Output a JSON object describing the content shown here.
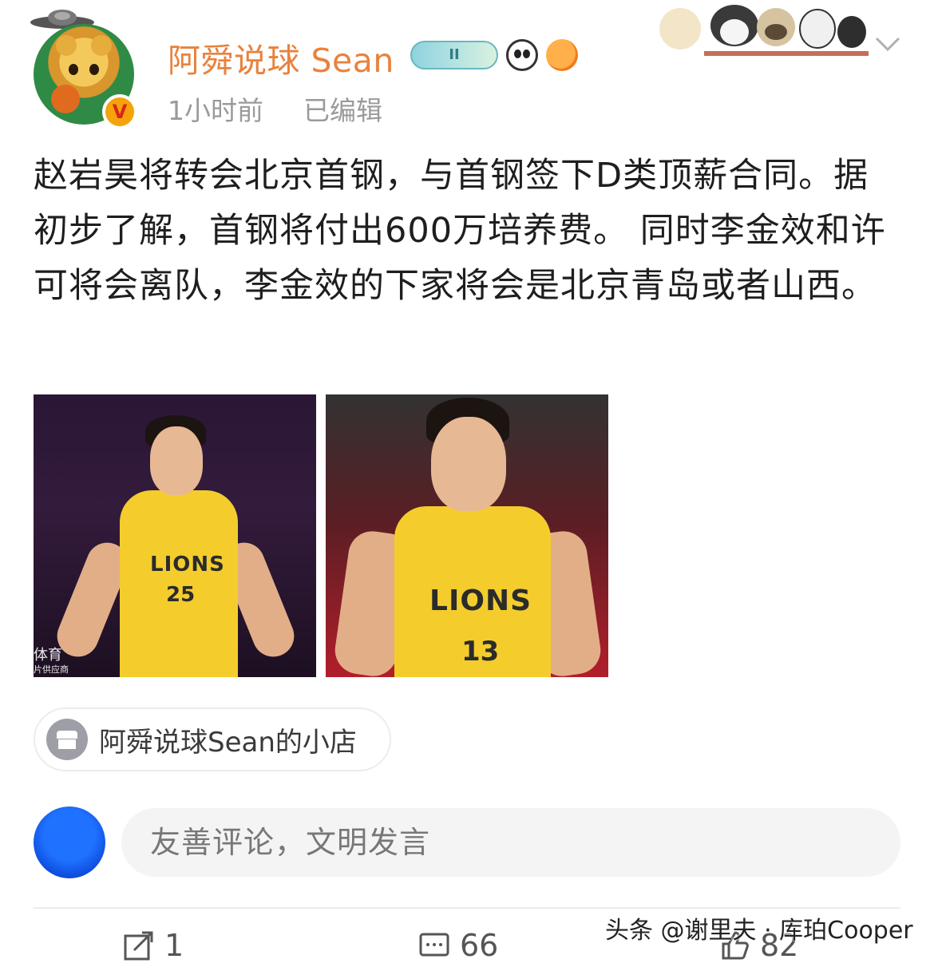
{
  "header": {
    "username": "阿舜说球 Sean",
    "level_badge": "II",
    "timestamp": "1小时前",
    "edited_label": "已编辑",
    "avatar_badge": "V"
  },
  "post": {
    "text": "赵岩昊将转会北京首钢，与首钢签下D类顶薪合同。据初步了解，首钢将付出600万培养费。 同时李金效和许可将会离队，李金效的下家将会是北京青岛或者山西。",
    "photos": [
      {
        "jersey_text": "LIONS",
        "jersey_number": "25",
        "corner_text_1": "体育",
        "corner_text_2": "片供应商"
      },
      {
        "jersey_text": "LIONS",
        "jersey_number": "13"
      }
    ]
  },
  "shop": {
    "label": "阿舜说球Sean的小店"
  },
  "comment": {
    "placeholder": "友善评论，文明发言"
  },
  "actions": {
    "share_count": "1",
    "comment_count": "66",
    "like_count": "82"
  },
  "watermark": "头条 @谢里夫 · 库珀Cooper",
  "colors": {
    "username": "#e8823d",
    "muted_text": "#9a9a9a",
    "jersey_yellow": "#f4cd2c"
  },
  "icons": [
    "ufo-icon",
    "verified-v-icon",
    "level-badge-icon",
    "panda-icon",
    "pufferfish-icon",
    "cat-stickers-icon",
    "chevron-down-icon",
    "shop-icon",
    "share-icon",
    "comment-icon",
    "like-icon"
  ]
}
